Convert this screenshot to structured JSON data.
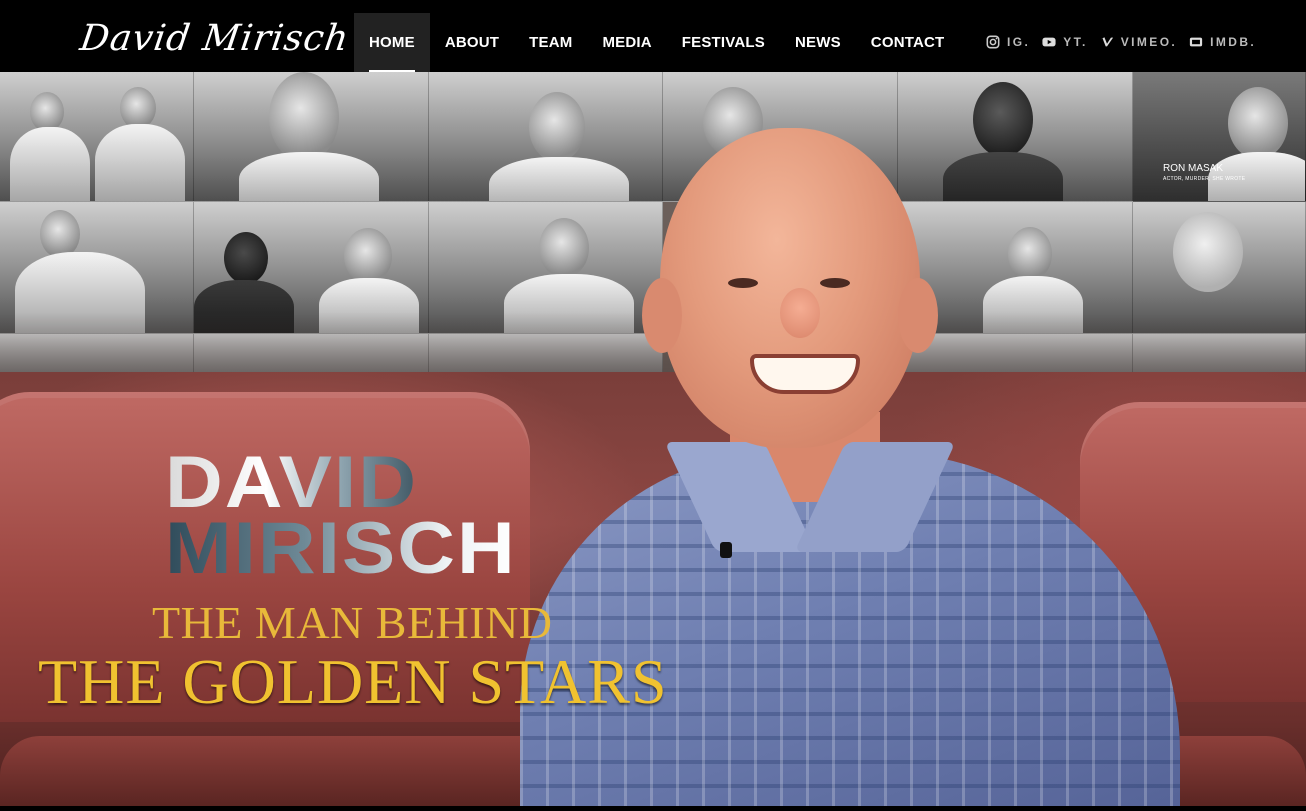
{
  "header": {
    "logo_text": "David Mirisch",
    "nav": [
      {
        "label": "HOME",
        "active": true
      },
      {
        "label": "ABOUT",
        "active": false
      },
      {
        "label": "TEAM",
        "active": false
      },
      {
        "label": "MEDIA",
        "active": false
      },
      {
        "label": "FESTIVALS",
        "active": false
      },
      {
        "label": "NEWS",
        "active": false
      },
      {
        "label": "CONTACT",
        "active": false
      }
    ],
    "social": [
      {
        "icon": "instagram-icon",
        "label": "IG."
      },
      {
        "icon": "youtube-icon",
        "label": "YT."
      },
      {
        "icon": "vimeo-icon",
        "label": "VIMEO."
      },
      {
        "icon": "imdb-icon",
        "label": "IMDB."
      }
    ]
  },
  "hero": {
    "tile_caption": {
      "name": "RON MASAK",
      "role": "ACTOR, MURDER, SHE WROTE"
    },
    "title_line1": "DAVID",
    "title_line2": "MIRISCH",
    "subtitle_line1": "THE MAN BEHIND",
    "subtitle_line2": "THE GOLDEN STARS"
  },
  "colors": {
    "header_bg": "#000000",
    "nav_text": "#ffffff",
    "active_nav_bg": "#222222",
    "gold": "#f0c230",
    "seat_red": "#9a4540"
  }
}
